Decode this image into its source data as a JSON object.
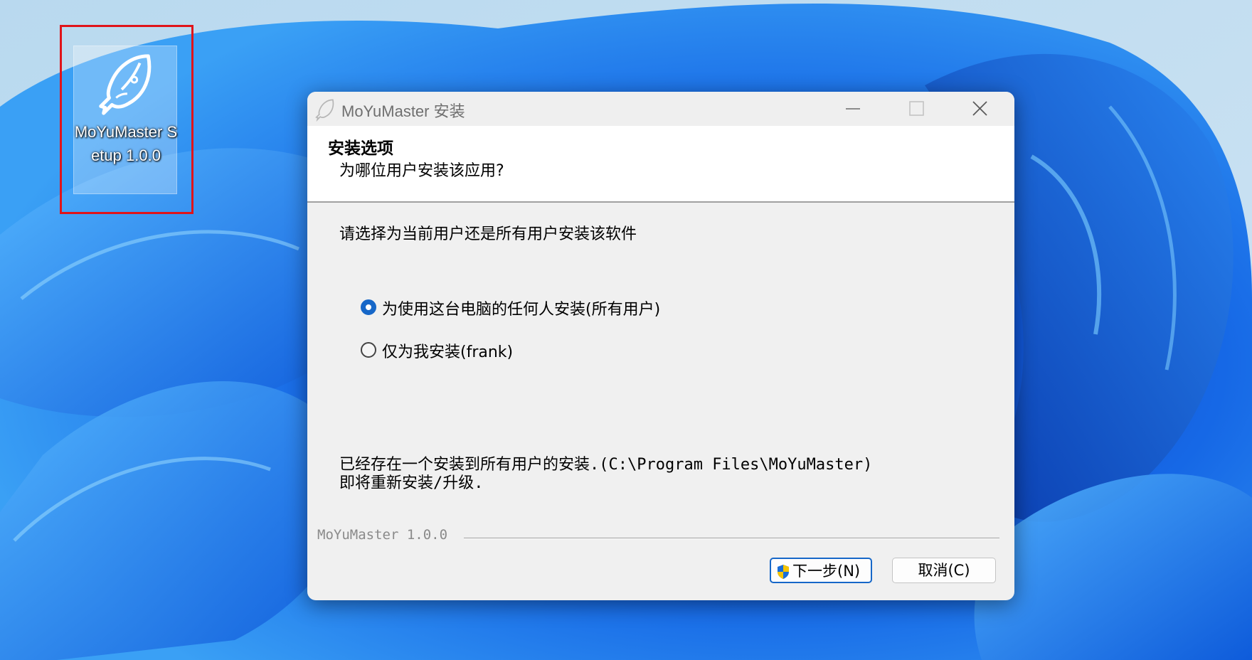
{
  "desktop": {
    "icon": {
      "icon_name": "fish-icon",
      "label": "MoYuMaster Setup 1.0.0",
      "highlight_color": "#e0141a"
    },
    "wallpaper_colors": [
      "#0a4fd8",
      "#2e8df0",
      "#8fc3e6"
    ]
  },
  "dialog": {
    "title": "MoYuMaster 安装",
    "controls": {
      "minimize": "minimize-icon",
      "maximize": "maximize-icon",
      "close": "close-icon"
    },
    "header": {
      "title": "安装选项",
      "subtitle": "为哪位用户安装该应用?"
    },
    "prompt": "请选择为当前用户还是所有用户安装该软件",
    "options": [
      {
        "label": "为使用这台电脑的任何人安装(所有用户)",
        "selected": true
      },
      {
        "label": "仅为我安装(frank)",
        "selected": false
      }
    ],
    "notice": {
      "line1": "已经存在一个安装到所有用户的安装.(C:\\Program Files\\MoYuMaster)",
      "line2": "即将重新安装/升级."
    },
    "brand": "MoYuMaster 1.0.0",
    "buttons": {
      "next": "下一步(N)",
      "cancel": "取消(C)"
    },
    "accent_color": "#1667c8"
  }
}
